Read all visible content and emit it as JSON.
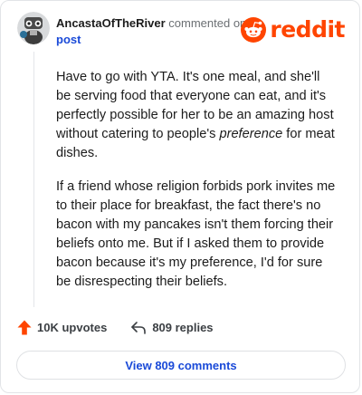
{
  "header": {
    "username": "AncastaOfTheRiver",
    "commented_on": "commented on",
    "post_link": "post",
    "brand": "reddit",
    "brand_color": "#ff4500"
  },
  "comment": {
    "paragraph1": {
      "before": "Have to go with YTA. It's one meal, and she'll be serving food that everyone can eat, and it's perfectly possible for her to be an amazing host without catering to people's ",
      "emphasis": "preference",
      "after": " for meat dishes."
    },
    "paragraph2": "If a friend whose religion forbids pork invites me to their place for breakfast, the fact there's no bacon with my pancakes isn't them forcing their beliefs onto me. But if I asked them to provide bacon because it's my preference, I'd for sure be disrespecting their beliefs."
  },
  "actions": {
    "upvotes_label": "10K upvotes",
    "replies_label": "809 replies"
  },
  "footer": {
    "view_comments_label": "View 809 comments"
  },
  "icons": {
    "upvote": "upvote-arrow-icon",
    "reply": "reply-arrow-icon",
    "avatar": "snoo-avatar",
    "brand": "snoo-logo-icon"
  }
}
